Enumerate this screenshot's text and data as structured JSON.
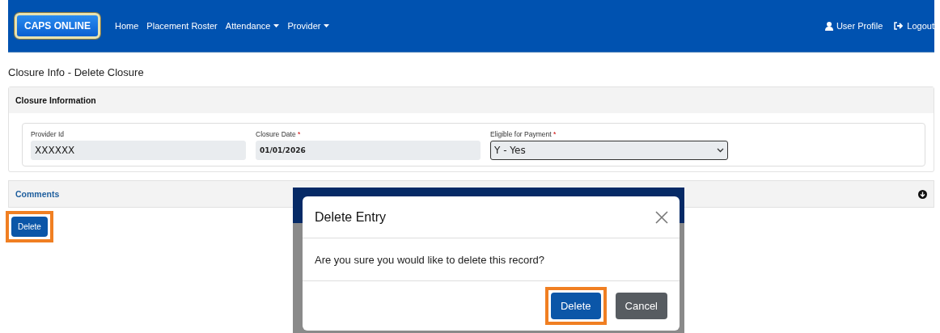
{
  "navbar": {
    "logo": "CAPS ONLINE",
    "links": [
      {
        "label": "Home",
        "dropdown": false
      },
      {
        "label": "Placement Roster",
        "dropdown": false
      },
      {
        "label": "Attendance",
        "dropdown": true
      },
      {
        "label": "Provider",
        "dropdown": true
      }
    ],
    "right_links": [
      {
        "label": "User Profile",
        "kind": "user"
      },
      {
        "label": "Logout",
        "kind": "logout"
      }
    ]
  },
  "page_title": "Closure Info - Delete Closure",
  "closure_section": {
    "title": "Closure Information",
    "fields": [
      {
        "label": "Provider Id",
        "kind": "readonly",
        "value": "XXXXXX",
        "bold": false
      },
      {
        "label": "Closure Date",
        "required_mark": "*",
        "kind": "readonly",
        "value": "01/01/2026",
        "bold": true
      },
      {
        "label": "Eligible for Payment",
        "required_mark": "*",
        "kind": "select",
        "value": "Y - Yes",
        "bold": false
      }
    ]
  },
  "comments_section": {
    "title": "Comments",
    "expanded": false
  },
  "delete_button": {
    "label": "Delete",
    "highlighted": true
  },
  "modal": {
    "title": "Delete Entry",
    "message": "Are you sure you would like to delete this record?",
    "buttons": [
      {
        "label": "Delete",
        "kind": "primary",
        "highlighted": true
      },
      {
        "label": "Cancel",
        "kind": "secondary"
      }
    ]
  }
}
